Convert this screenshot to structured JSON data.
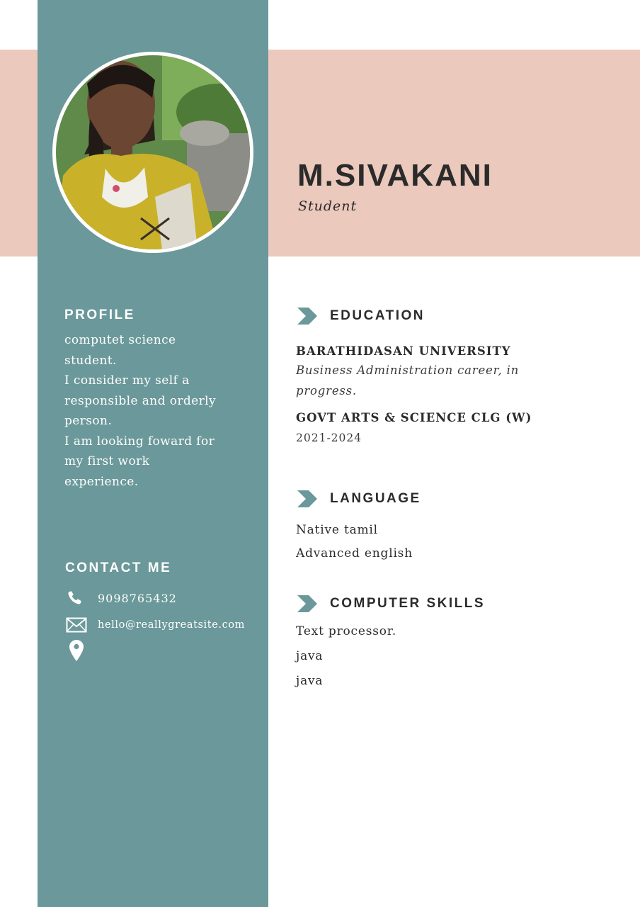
{
  "header": {
    "name": "M.SIVAKANI",
    "role": "Student"
  },
  "colors": {
    "sidebar": "#6b989a",
    "band": "#ebc9bc",
    "text_dark": "#2b2b2b",
    "accent_chevron": "#6b989a"
  },
  "profile": {
    "heading": "PROFILE",
    "lines": [
      "computet science",
      "student.",
      "I consider my self a",
      "responsible and orderly",
      "person.",
      "I am looking foward for",
      "my first work",
      "experience."
    ]
  },
  "contact": {
    "heading": "CONTACT ME",
    "phone_icon": "phone-icon",
    "phone": "9098765432",
    "email_icon": "envelope-icon",
    "email": "hello@reallygreatsite.com",
    "location_icon": "location-pin-icon"
  },
  "education": {
    "heading": "EDUCATION",
    "entries": [
      {
        "school": "BARATHIDASAN UNIVERSITY",
        "detail": "Business Administration career, in progress."
      },
      {
        "school": "GOVT ARTS & SCIENCE CLG (W)",
        "years": "2021-2024"
      }
    ]
  },
  "language": {
    "heading": "LANGUAGE",
    "items": [
      "Native tamil",
      "Advanced english"
    ]
  },
  "skills": {
    "heading": "COMPUTER SKILLS",
    "items": [
      "Text processor.",
      "java",
      "java"
    ]
  }
}
